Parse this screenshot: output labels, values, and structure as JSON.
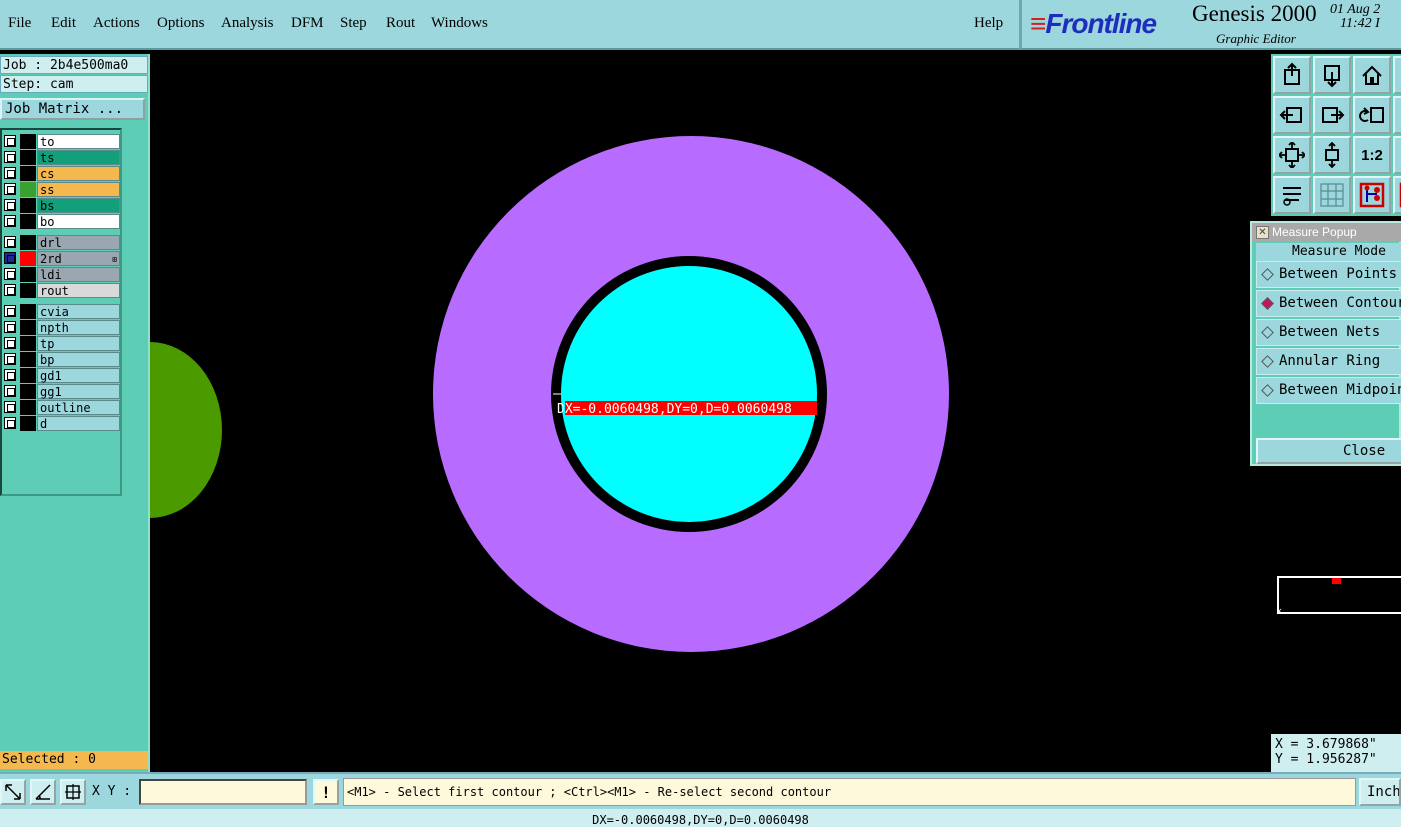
{
  "menu": {
    "items": [
      "File",
      "Edit",
      "Actions",
      "Options",
      "Analysis",
      "DFM",
      "Step",
      "Rout",
      "Windows"
    ],
    "help": "Help"
  },
  "brand": {
    "logo": "Frontline",
    "product": "Genesis 2000",
    "subtitle": "Graphic Editor",
    "date": "01 Aug 2",
    "time": "11:42 I"
  },
  "job": {
    "job_label": "Job : 2b4e500ma0",
    "step_label": "Step: cam",
    "matrix_button": "Job Matrix ..."
  },
  "layers": [
    {
      "name": "to",
      "bg": "#ffffff",
      "color": "#000000",
      "group": 0
    },
    {
      "name": "ts",
      "bg": "#12a07a",
      "color": "#000000",
      "group": 0
    },
    {
      "name": "cs",
      "bg": "#f5b84e",
      "color": "#000000",
      "group": 0
    },
    {
      "name": "ss",
      "bg": "#f5b84e",
      "color": "#3aa030",
      "group": 0
    },
    {
      "name": "bs",
      "bg": "#12a07a",
      "color": "#000000",
      "group": 0
    },
    {
      "name": "bo",
      "bg": "#ffffff",
      "color": "#000000",
      "group": 0
    },
    {
      "name": "drl",
      "bg": "#9aa7b0",
      "color": "#000000",
      "group": 1
    },
    {
      "name": "2rd",
      "bg": "#9aa7b0",
      "color": "#ff0000",
      "group": 1,
      "active": true
    },
    {
      "name": "ldi",
      "bg": "#9aa7b0",
      "color": "#000000",
      "group": 1
    },
    {
      "name": "rout",
      "bg": "#d9d9d9",
      "color": "#000000",
      "group": 1
    },
    {
      "name": "cvia",
      "bg": "#9cd7dd",
      "color": "#000000",
      "group": 2
    },
    {
      "name": "npth",
      "bg": "#9cd7dd",
      "color": "#000000",
      "group": 2
    },
    {
      "name": "tp",
      "bg": "#9cd7dd",
      "color": "#000000",
      "group": 2
    },
    {
      "name": "bp",
      "bg": "#9cd7dd",
      "color": "#000000",
      "group": 2
    },
    {
      "name": "gd1",
      "bg": "#9cd7dd",
      "color": "#000000",
      "group": 2
    },
    {
      "name": "gg1",
      "bg": "#9cd7dd",
      "color": "#000000",
      "group": 2
    },
    {
      "name": "outline",
      "bg": "#9cd7dd",
      "color": "#000000",
      "group": 2
    },
    {
      "name": "d",
      "bg": "#9cd7dd",
      "color": "#000000",
      "group": 2
    }
  ],
  "selected_label": "Selected : 0",
  "canvas": {
    "measure_label": "DX=-0.0060498,DY=0,D=0.0060498",
    "colors": {
      "pad": "#b86cff",
      "hole": "#00ffff",
      "green": "#4a9a00",
      "measure": "#ff0000"
    }
  },
  "toolbar_icons": [
    "zoom-home-up-icon",
    "zoom-home-down-icon",
    "home-icon",
    "page-right-icon",
    "pan-left-icon",
    "pan-right-icon",
    "undo-zoom-icon",
    "redo-zoom-icon",
    "fit-all-icon",
    "fit-profile-icon",
    "one-to-one-icon",
    "zoom-box-icon",
    "tools-icon",
    "grid-icon",
    "snap-icon",
    "net-icon"
  ],
  "one_to_one": "1:2",
  "measure_popup": {
    "title": "Measure Popup",
    "mode_label": "Measure Mode",
    "options": [
      "Between Points",
      "Between Contours",
      "Between Nets",
      "Annular Ring",
      "Between Midpoints"
    ],
    "selected_index": 1,
    "close": "Close"
  },
  "coords": {
    "x": "X = 3.679868\"",
    "y": "Y = 1.956287\""
  },
  "bottom": {
    "xy_label": "X Y :",
    "xy_value": "",
    "prompt": "<M1> - Select first contour ; <Ctrl><M1> - Re-select second contour",
    "units": "Inch"
  },
  "status": "DX=-0.0060498,DY=0,D=0.0060498"
}
